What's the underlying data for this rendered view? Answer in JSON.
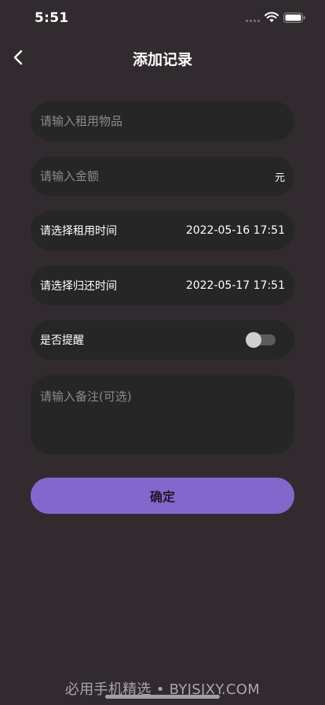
{
  "status_bar": {
    "time": "5:51"
  },
  "nav": {
    "title": "添加记录"
  },
  "form": {
    "item": {
      "placeholder": "请输入租用物品",
      "value": ""
    },
    "amount": {
      "placeholder": "请输入金额",
      "value": "",
      "suffix": "元"
    },
    "rent_time": {
      "label": "请选择租用时间",
      "value": "2022-05-16 17:51"
    },
    "return_time": {
      "label": "请选择归还时间",
      "value": "2022-05-17 17:51"
    },
    "reminder": {
      "label": "是否提醒",
      "enabled": false
    },
    "remark": {
      "placeholder": "请输入备注(可选)",
      "value": ""
    }
  },
  "confirm_label": "确定",
  "watermark": "必用手机精选 • BYJSJXY.COM",
  "colors": {
    "background": "#312b2f",
    "field": "#262627",
    "accent": "#8467cc"
  }
}
